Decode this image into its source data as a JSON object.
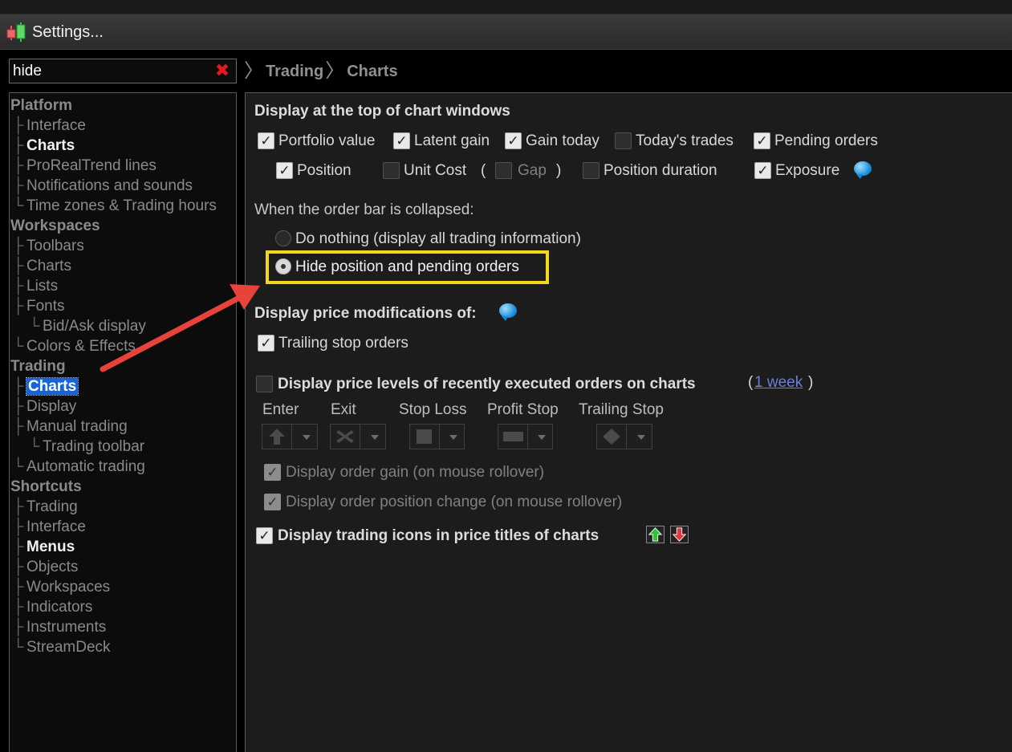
{
  "window": {
    "title": "Settings..."
  },
  "search": {
    "value": "hide"
  },
  "breadcrumb": [
    "Trading",
    "Charts"
  ],
  "tree": [
    {
      "label": "Platform",
      "type": "cat"
    },
    {
      "label": "Interface",
      "type": "lvl1"
    },
    {
      "label": "Charts",
      "type": "lvl1",
      "bold": true
    },
    {
      "label": "ProRealTrend lines",
      "type": "lvl1"
    },
    {
      "label": "Notifications and sounds",
      "type": "lvl1"
    },
    {
      "label": "Time zones & Trading hours",
      "type": "lvl1"
    },
    {
      "label": "Workspaces",
      "type": "cat"
    },
    {
      "label": "Toolbars",
      "type": "lvl1"
    },
    {
      "label": "Charts",
      "type": "lvl1"
    },
    {
      "label": "Lists",
      "type": "lvl1"
    },
    {
      "label": "Fonts",
      "type": "lvl1"
    },
    {
      "label": "Bid/Ask display",
      "type": "lvl2"
    },
    {
      "label": "Colors & Effects",
      "type": "lvl1"
    },
    {
      "label": "Trading",
      "type": "cat"
    },
    {
      "label": "Charts",
      "type": "lvl1",
      "selected": true
    },
    {
      "label": "Display",
      "type": "lvl1"
    },
    {
      "label": "Manual trading",
      "type": "lvl1"
    },
    {
      "label": "Trading toolbar",
      "type": "lvl2"
    },
    {
      "label": "Automatic trading",
      "type": "lvl1"
    },
    {
      "label": "Shortcuts",
      "type": "cat"
    },
    {
      "label": "Trading",
      "type": "lvl1"
    },
    {
      "label": "Interface",
      "type": "lvl1"
    },
    {
      "label": "Menus",
      "type": "lvl1",
      "bold": true
    },
    {
      "label": "Objects",
      "type": "lvl1"
    },
    {
      "label": "Workspaces",
      "type": "lvl1"
    },
    {
      "label": "Indicators",
      "type": "lvl1"
    },
    {
      "label": "Instruments",
      "type": "lvl1"
    },
    {
      "label": "StreamDeck",
      "type": "lvl1"
    }
  ],
  "section1": {
    "heading": "Display at the top of chart windows",
    "row1": [
      {
        "label": "Portfolio value",
        "checked": true
      },
      {
        "label": "Latent gain",
        "checked": true
      },
      {
        "label": "Gain today",
        "checked": true
      },
      {
        "label": "Today's trades",
        "checked": false
      },
      {
        "label": "Pending orders",
        "checked": true
      }
    ],
    "row2": [
      {
        "label": "Position",
        "checked": true
      },
      {
        "label": "Unit Cost",
        "checked": false
      },
      {
        "label": "Gap",
        "checked": false,
        "disabled": true
      },
      {
        "label": "Position duration",
        "checked": false
      },
      {
        "label": "Exposure",
        "checked": true
      }
    ],
    "paren_open": "(",
    "paren_close": ")"
  },
  "order_bar": {
    "label": "When the order bar is collapsed:",
    "options": [
      {
        "label": "Do nothing (display all trading information)",
        "selected": false
      },
      {
        "label": "Hide position and pending orders",
        "selected": true
      }
    ]
  },
  "price_mods": {
    "heading": "Display price modifications of:",
    "trailing": {
      "label": "Trailing stop orders",
      "checked": true
    }
  },
  "levels": {
    "label": "Display price levels of recently executed orders on charts",
    "paren_open": "(",
    "link": "1 week",
    "paren_close": ")",
    "checked": false,
    "columns": [
      "Enter",
      "Exit",
      "Stop Loss",
      "Profit Stop",
      "Trailing Stop"
    ],
    "order_gain": {
      "label": "Display order gain (on mouse rollover)",
      "checked": true
    },
    "position_change": {
      "label": "Display order position change (on mouse rollover)",
      "checked": true
    }
  },
  "trading_icons": {
    "label": "Display trading icons in price titles of charts",
    "checked": true
  },
  "colors": {
    "selection": "#1565d8",
    "highlight": "#f4d61d",
    "arrow": "#e8433a",
    "link": "#6b7fd6"
  }
}
